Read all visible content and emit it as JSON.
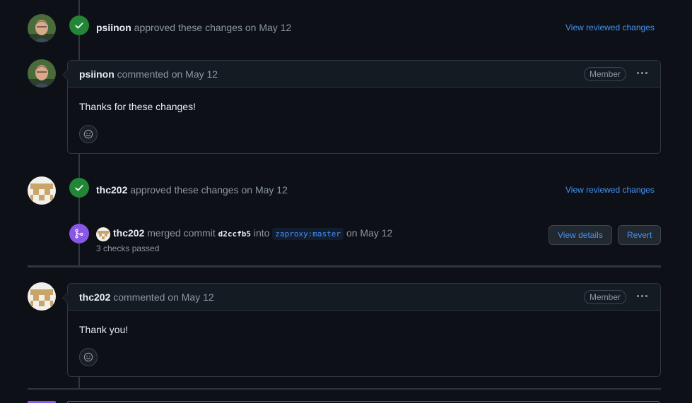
{
  "events": {
    "approval1": {
      "user": "psiinon",
      "action": "approved these changes on May 12",
      "link": "View reviewed changes"
    },
    "comment1": {
      "user": "psiinon",
      "meta": "commented on May 12",
      "role": "Member",
      "body": "Thanks for these changes!"
    },
    "approval2": {
      "user": "thc202",
      "action": "approved these changes on May 12",
      "link": "View reviewed changes"
    },
    "merge": {
      "user": "thc202",
      "text1": "merged commit",
      "sha": "d2ccfb5",
      "text2": "into",
      "branch": "zaproxy:master",
      "date": "on May 12",
      "checks": "3 checks passed",
      "view_details": "View details",
      "revert": "Revert"
    },
    "comment2": {
      "user": "thc202",
      "meta": "commented on May 12",
      "role": "Member",
      "body": "Thank you!"
    }
  },
  "colors": {
    "background": "#0d1117",
    "approve_badge": "#238636",
    "merge_badge": "#8957e5",
    "link": "#4493f8"
  },
  "icons": [
    "check-icon",
    "merge-icon",
    "smiley-icon",
    "kebab-icon"
  ]
}
